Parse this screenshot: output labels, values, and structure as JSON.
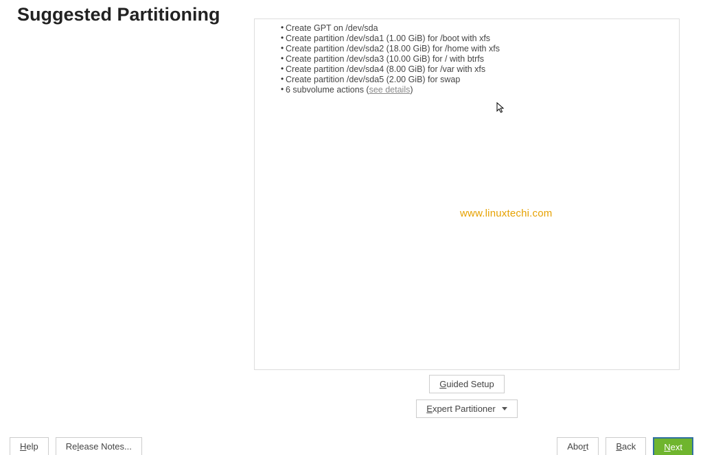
{
  "header": {
    "title": "Suggested Partitioning"
  },
  "panel": {
    "items": [
      "Create GPT on /dev/sda",
      "Create partition /dev/sda1 (1.00 GiB) for /boot with xfs",
      "Create partition /dev/sda2 (18.00 GiB) for /home with xfs",
      "Create partition /dev/sda3 (10.00 GiB) for / with btrfs",
      "Create partition /dev/sda4 (8.00 GiB) for /var with xfs",
      "Create partition /dev/sda5 (2.00 GiB) for swap"
    ],
    "subvolume_prefix": "6 subvolume actions (",
    "subvolume_link": "see details",
    "subvolume_suffix": ")"
  },
  "watermark": "www.linuxtechi.com",
  "centerButtons": {
    "guided_pre": "G",
    "guided_post": "uided Setup",
    "expert_pre": "E",
    "expert_post": "xpert Partitioner"
  },
  "bottomBar": {
    "help_pre": "H",
    "help_post": "elp",
    "release_pre": "Re",
    "release_mid": "l",
    "release_post": "ease Notes...",
    "abort_pre": "Abo",
    "abort_mid": "r",
    "abort_post": "t",
    "back_pre": "B",
    "back_post": "ack",
    "next_pre": "N",
    "next_post": "ext"
  }
}
